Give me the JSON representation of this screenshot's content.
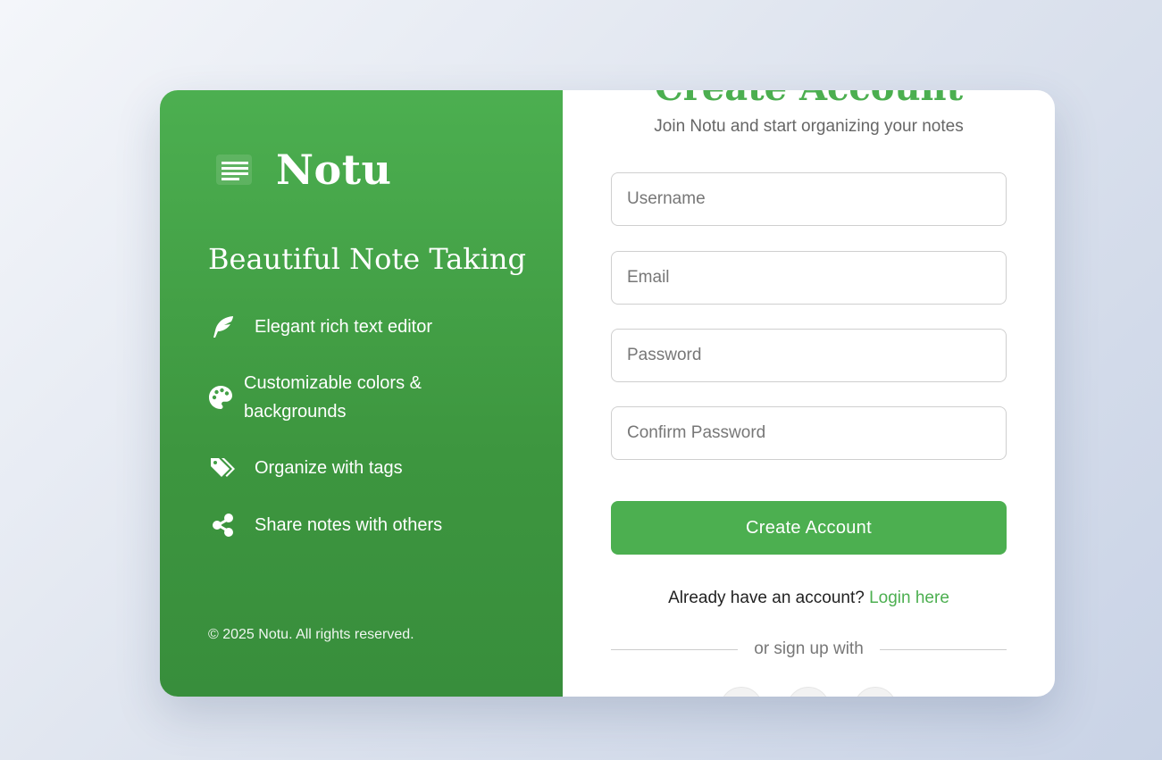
{
  "brand": {
    "name": "Notu"
  },
  "left": {
    "tagline": "Beautiful Note Taking",
    "features": [
      {
        "icon": "feather-icon",
        "label": "Elegant rich text editor"
      },
      {
        "icon": "palette-icon",
        "label": "Customizable colors & backgrounds"
      },
      {
        "icon": "tags-icon",
        "label": "Organize with tags"
      },
      {
        "icon": "share-icon",
        "label": "Share notes with others"
      }
    ],
    "copyright": "© 2025 Notu. All rights reserved."
  },
  "form": {
    "title": "Create Account",
    "subtitle": "Join Notu and start organizing your notes",
    "username_placeholder": "Username",
    "email_placeholder": "Email",
    "password_placeholder": "Password",
    "confirm_placeholder": "Confirm Password",
    "submit_label": "Create Account",
    "login_prompt": "Already have an account?",
    "login_link": "Login here",
    "divider_text": "or sign up with"
  },
  "colors": {
    "accent": "#4caf50",
    "accent_dark": "#388e3c",
    "background": "#dde3ee"
  }
}
